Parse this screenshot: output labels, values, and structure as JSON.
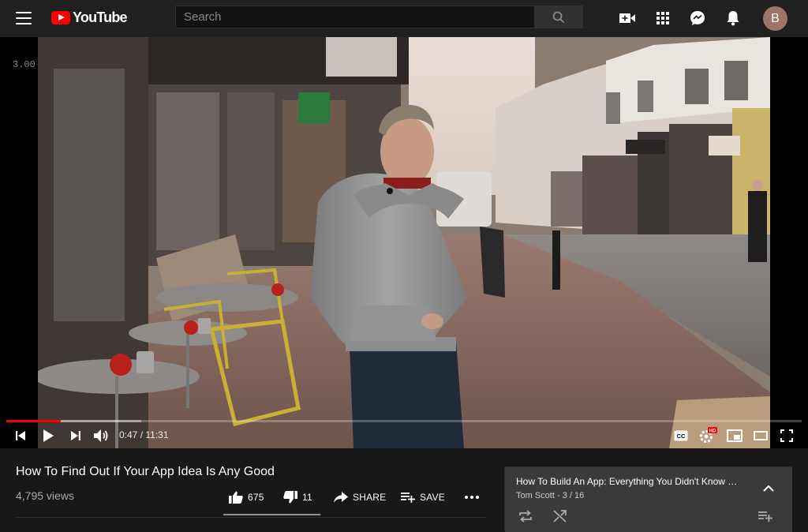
{
  "header": {
    "logo_text": "YouTube",
    "search_placeholder": "Search",
    "avatar_letter": "B",
    "icons": [
      "menu-icon",
      "search-icon",
      "create-video-icon",
      "apps-grid-icon",
      "messages-icon",
      "notifications-bell-icon"
    ]
  },
  "player": {
    "speed_label": "3.00",
    "current_time": "0:47",
    "separator": " / ",
    "duration": "11:31",
    "progress_played": 0.068,
    "progress_loaded": 0.17,
    "icons": [
      "previous-icon",
      "play-icon",
      "next-icon",
      "volume-icon",
      "captions-icon",
      "settings-hd-icon",
      "miniplayer-icon",
      "theater-mode-icon",
      "fullscreen-icon"
    ]
  },
  "video": {
    "title": "How To Find Out If Your App Idea Is Any Good",
    "views": "4,795 views",
    "likes": "675",
    "dislikes": "11",
    "share_label": "SHARE",
    "save_label": "SAVE",
    "like_ratio": 0.984
  },
  "playlist": {
    "title": "How To Build An App: Everything You Didn't Know …",
    "owner": "Tom Scott",
    "position": "3 / 16",
    "sep": " - ",
    "icons": [
      "collapse-chevron-icon",
      "loop-icon",
      "shuffle-icon",
      "add-to-queue-icon"
    ]
  },
  "colors": {
    "accent": "#ff0000",
    "background": "#181818",
    "header": "#202020"
  }
}
